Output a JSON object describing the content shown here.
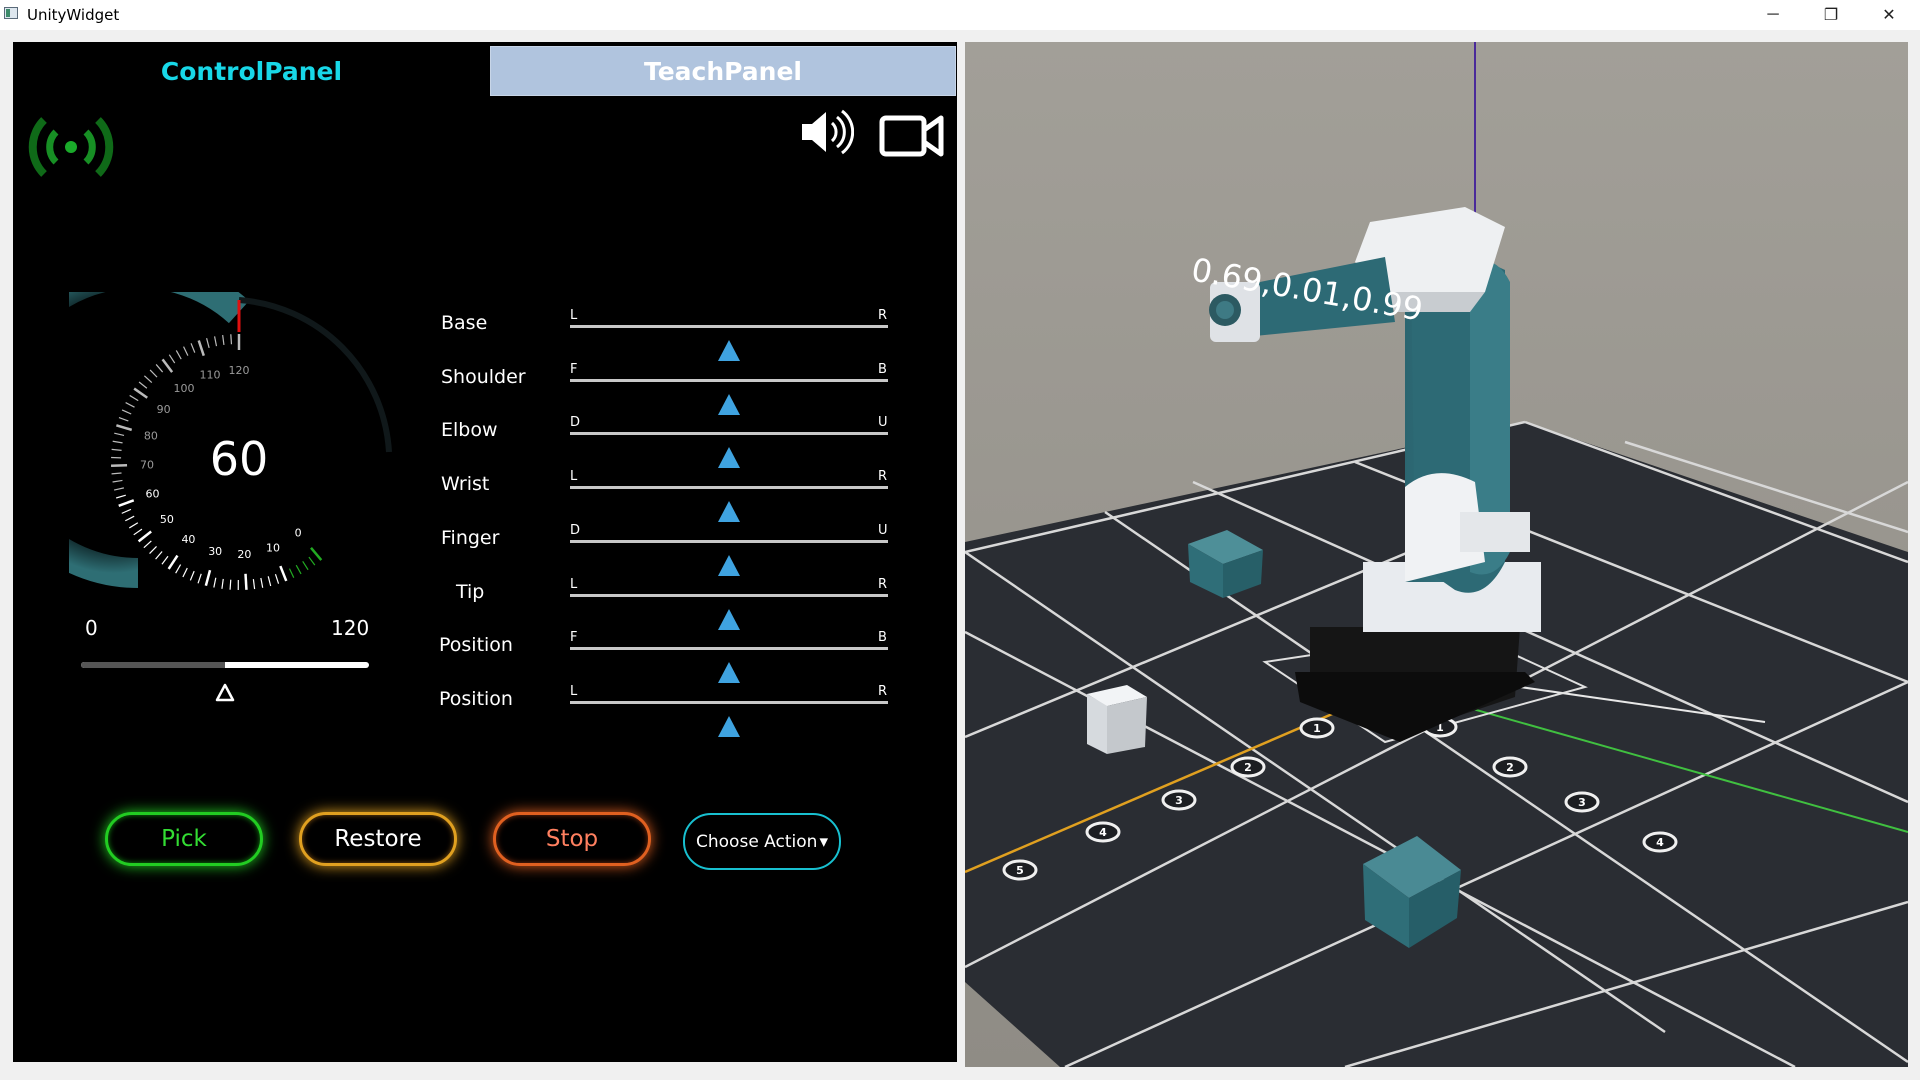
{
  "window": {
    "title": "UnityWidget",
    "minimize_glyph": "─",
    "restore_glyph": "❐",
    "close_glyph": "✕"
  },
  "tabs": {
    "control": "ControlPanel",
    "teach": "TeachPanel"
  },
  "icons": {
    "signal": "wireless-signal-icon",
    "speaker": "speaker-icon",
    "camera": "video-camera-icon"
  },
  "gauge": {
    "value": "60",
    "value_num": 60,
    "max": 120,
    "ticks": [
      "0",
      "10",
      "20",
      "30",
      "40",
      "50",
      "60",
      "70",
      "80",
      "90",
      "100",
      "110",
      "120"
    ],
    "min_label": "0",
    "max_label": "120",
    "slider_fraction": 0.5
  },
  "joints": [
    {
      "label": "Base",
      "left": "L",
      "right": "R",
      "value": 0.5
    },
    {
      "label": "Shoulder",
      "left": "F",
      "right": "B",
      "value": 0.5
    },
    {
      "label": "Elbow",
      "left": "D",
      "right": "U",
      "value": 0.5
    },
    {
      "label": "Wrist",
      "left": "L",
      "right": "R",
      "value": 0.5
    },
    {
      "label": "Finger",
      "left": "D",
      "right": "U",
      "value": 0.5
    },
    {
      "label": "Tip",
      "left": "L",
      "right": "R",
      "value": 0.5
    },
    {
      "label": "Position",
      "left": "F",
      "right": "B",
      "value": 0.5
    },
    {
      "label": "Position",
      "left": "L",
      "right": "R",
      "value": 0.5
    }
  ],
  "actions": {
    "pick": "Pick",
    "restore": "Restore",
    "stop": "Stop",
    "choose": "Choose Action",
    "choose_arrow": "▾"
  },
  "scene": {
    "coordinate_readout": "0.69,0.01,0.99",
    "axis_markers": [
      "1",
      "2",
      "3",
      "4",
      "5",
      "1",
      "2",
      "3",
      "4"
    ],
    "colors": {
      "floor": "#2a2d33",
      "arm": "#2f6e78",
      "arm_white": "#e8ebef",
      "base": "#151515",
      "x_axis": "#e0a020",
      "z_axis": "#40c040"
    }
  }
}
